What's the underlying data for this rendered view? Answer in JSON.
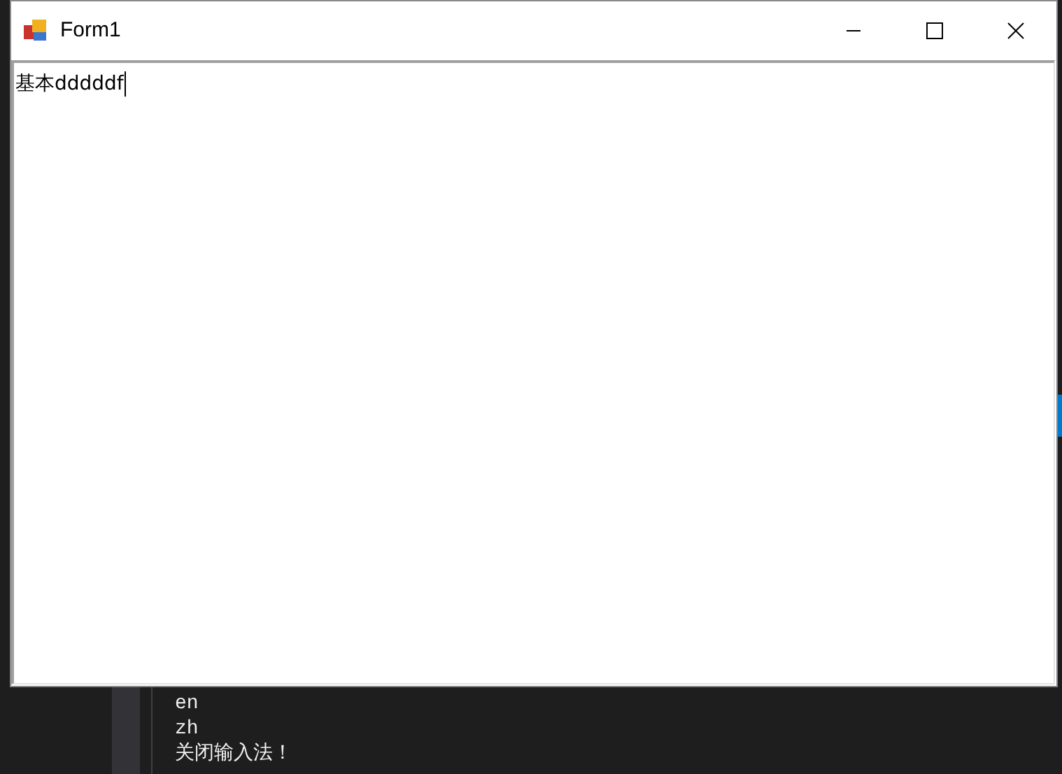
{
  "window": {
    "title": "Form1"
  },
  "text_box": {
    "value": "基本dddddf"
  },
  "console": {
    "lines": [
      "en",
      "zh",
      "关闭输入法！"
    ]
  }
}
